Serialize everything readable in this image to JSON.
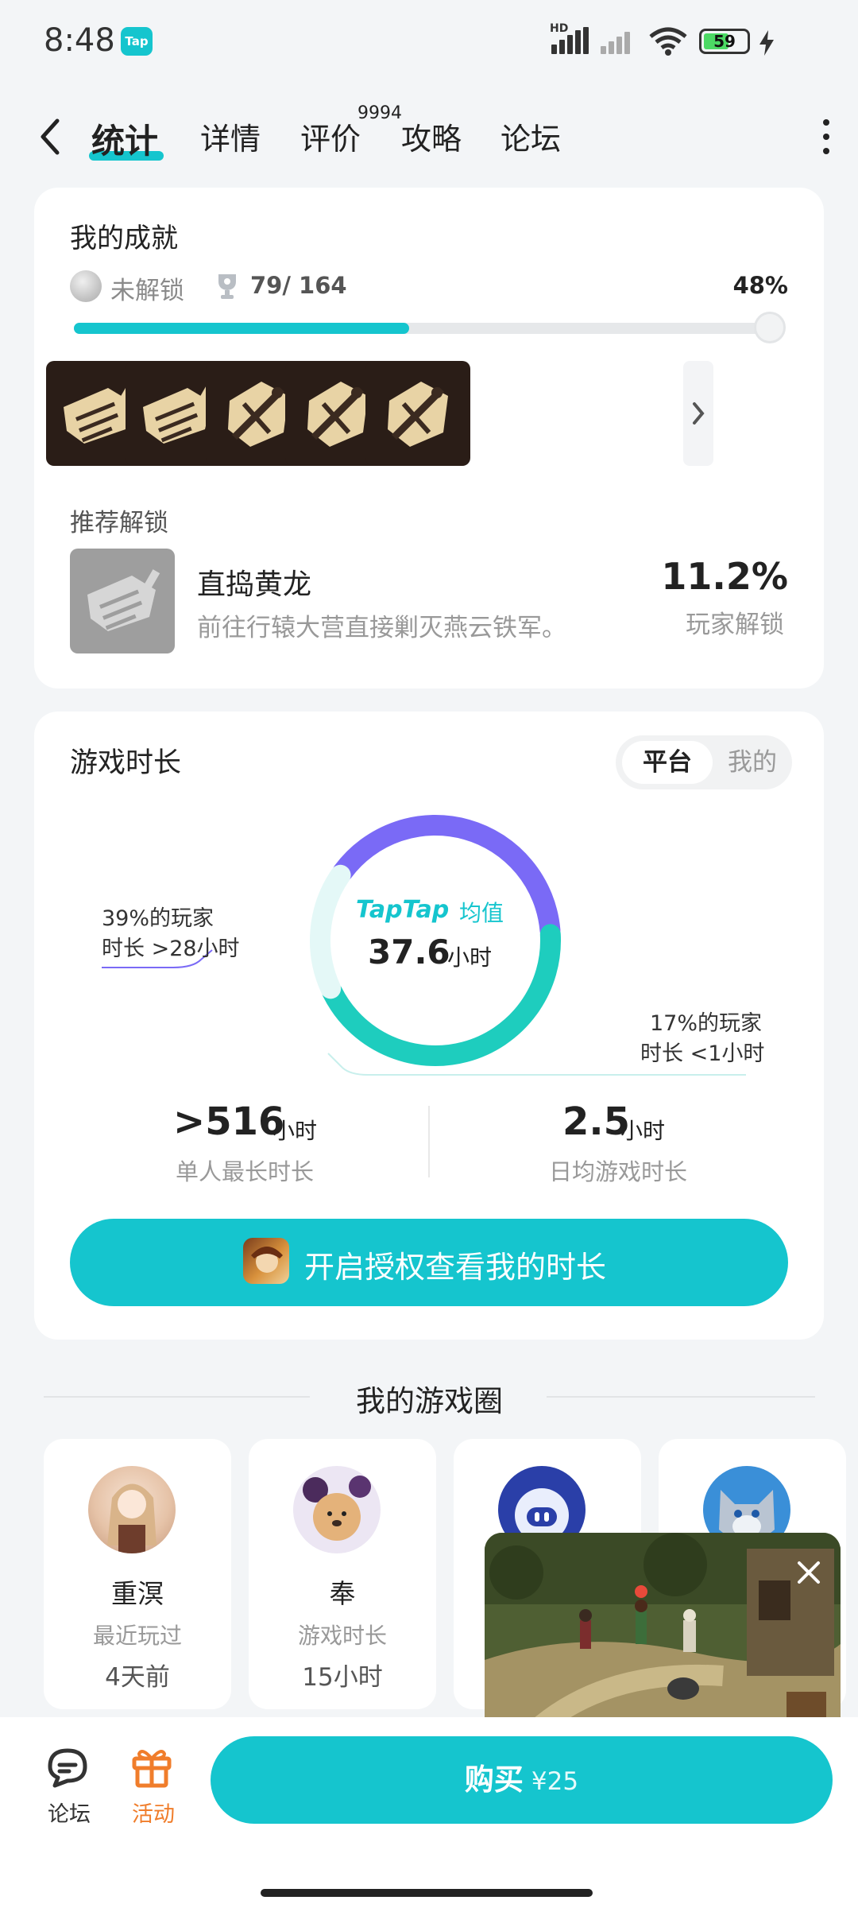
{
  "status_bar": {
    "time": "8:48",
    "app_badge": "Tap",
    "network_label": "HD",
    "battery": "59",
    "battery_level": 0.59
  },
  "nav": {
    "tabs": [
      {
        "label": "统计"
      },
      {
        "label": "详情"
      },
      {
        "label": "评价"
      },
      {
        "label": "攻略"
      },
      {
        "label": "论坛"
      }
    ],
    "review_count": "9994"
  },
  "achievements": {
    "title": "我的成就",
    "locked_label": "未解锁",
    "count": "79/ 164",
    "percent_text": "48%",
    "progress": 0.48,
    "recommend_label": "推荐解锁",
    "recommended": {
      "name": "直捣黄龙",
      "desc": "前往行辕大营直接剿灭燕云铁军。",
      "rate": "11.2%",
      "rate_label": "玩家解锁"
    }
  },
  "playtime": {
    "title": "游戏时长",
    "toggle": {
      "platform": "平台",
      "mine": "我的"
    },
    "brand": "TapTap",
    "brand_suffix": "均值",
    "avg_value": "37.6",
    "avg_unit": "小时",
    "left_note": {
      "line1": "39%的玩家",
      "line2": "时长 >28小时"
    },
    "right_note": {
      "line1": "17%的玩家",
      "line2": "时长 <1小时"
    },
    "segments": [
      {
        "share": 0.39,
        "color": "#7a6af6"
      },
      {
        "share": 0.44,
        "color": "#1ecdbe"
      },
      {
        "share": 0.17,
        "color": "#e4f8f7"
      }
    ],
    "max_value": ">516",
    "max_unit": "小时",
    "max_label": "单人最长时长",
    "daily_value": "2.5",
    "daily_unit": "小时",
    "daily_label": "日均游戏时长",
    "auth_button": "开启授权查看我的时长"
  },
  "circle": {
    "title": "我的游戏圈",
    "friends": [
      {
        "name": "重溟",
        "meta": "最近玩过",
        "value": "4天前"
      },
      {
        "name": "奉",
        "meta": "游戏时长",
        "value": "15小时"
      }
    ]
  },
  "bottom_bar": {
    "forum": "论坛",
    "event": "活动",
    "buy": "购买",
    "price": "¥25"
  },
  "colors": {
    "accent": "#15c5ce",
    "purple": "#7a6af6",
    "event_orange": "#f07d2b"
  }
}
